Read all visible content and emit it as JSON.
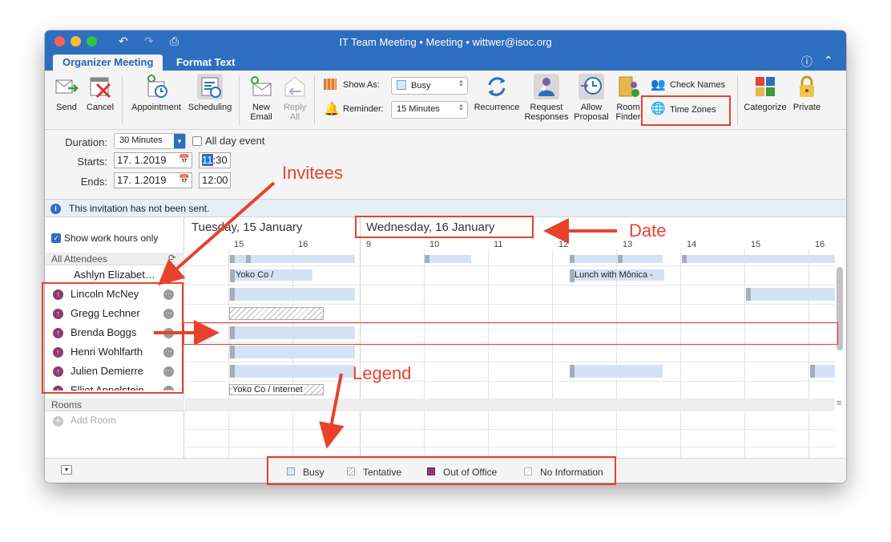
{
  "window": {
    "title": "IT Team Meeting • Meeting • wittwer@isoc.org"
  },
  "tabs": [
    {
      "label": "Organizer Meeting"
    },
    {
      "label": "Format Text"
    }
  ],
  "ribbon": {
    "send": "Send",
    "cancel": "Cancel",
    "appointment": "Appointment",
    "scheduling": "Scheduling",
    "new_email": "New Email",
    "reply_all": "Reply All",
    "show_as_label": "Show As:",
    "show_as_value": "Busy",
    "reminder_label": "Reminder:",
    "reminder_value": "15 Minutes",
    "recurrence": "Recurrence",
    "request_responses": "Request Responses",
    "allow_proposal": "Allow Proposal",
    "room_finder": "Room Finder",
    "check_names": "Check Names",
    "time_zones": "Time Zones",
    "categorize": "Categorize",
    "private": "Private"
  },
  "form": {
    "duration_label": "Duration:",
    "duration_value": "30 Minutes",
    "all_day_label": "All day event",
    "starts_label": "Starts:",
    "start_date": "17. 1.2019",
    "start_time_hour": "11",
    "start_time_min": ":30",
    "ends_label": "Ends:",
    "end_date": "17. 1.2019",
    "end_time": "12:00"
  },
  "info": {
    "message": "This invitation has not been sent."
  },
  "scheduler": {
    "show_work_hours": "Show work hours only",
    "all_attendees": "All Attendees",
    "organizer": "Ashlyn Elizabet…",
    "attendees": [
      {
        "name": "Lincoln McNey"
      },
      {
        "name": "Gregg Lechner"
      },
      {
        "name": "Brenda Boggs"
      },
      {
        "name": "Henri Wohlfarth"
      },
      {
        "name": "Julien Demierre"
      },
      {
        "name": "Elliot Appelstein"
      }
    ],
    "rooms": "Rooms",
    "add_room": "Add Room",
    "day1": "Tuesday, 15 January",
    "day2": "Wednesday, 16 January",
    "hours": [
      "15",
      "16",
      "9",
      "10",
      "11",
      "12",
      "13",
      "14",
      "15",
      "16"
    ],
    "event_yoko": "Yoko Co /",
    "event_lunch": "Lunch with Mônica -",
    "event_yoko_internet": "Yoko Co / Internet"
  },
  "legend": {
    "busy": "Busy",
    "tentative": "Tentative",
    "out_of_office": "Out of Office",
    "no_info": "No Information"
  },
  "annotations": {
    "invitees": "Invitees",
    "date": "Date",
    "legend": "Legend"
  },
  "colors": {
    "accent": "#2e6ec0",
    "annotation": "#e8412c",
    "busy": "#d4e3f3",
    "out_of_office": "#8e3a6e"
  }
}
